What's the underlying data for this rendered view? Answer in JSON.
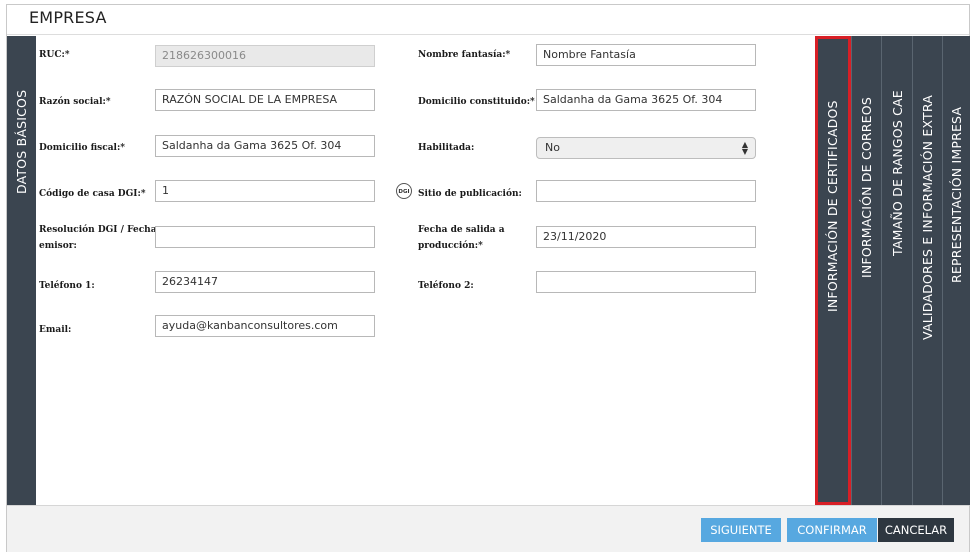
{
  "window": {
    "title": "EMPRESA"
  },
  "left_tab": {
    "label": "DATOS BÁSICOS"
  },
  "form": {
    "ruc": {
      "label": "RUC:*",
      "value": "218626300016"
    },
    "nombre_fantasia": {
      "label": "Nombre fantasía:*",
      "value": "Nombre Fantasía"
    },
    "razon_social": {
      "label": "Razón social:*",
      "value": "RAZÓN SOCIAL DE LA EMPRESA"
    },
    "domicilio_constituido": {
      "label": "Domicilio constituido:*",
      "value": "Saldanha da Gama 3625 Of. 304"
    },
    "domicilio_fiscal": {
      "label": "Domicilio fiscal:*",
      "value": "Saldanha da Gama 3625 Of. 304"
    },
    "habilitada": {
      "label": "Habilitada:",
      "value": "No"
    },
    "codigo_casa": {
      "label": "Código de casa DGI:*",
      "value": "1"
    },
    "dgi_icon": {
      "text": "DGI"
    },
    "sitio_publicacion": {
      "label": "Sitio de publicación:",
      "value": ""
    },
    "resolucion": {
      "label_line1": "Resolución DGI / Fecha",
      "label_line2": "emisor:",
      "value": ""
    },
    "fecha_salida": {
      "label_line1": "Fecha de salida a",
      "label_line2": "producción:*",
      "value": "23/11/2020"
    },
    "telefono1": {
      "label": "Teléfono 1:",
      "value": "26234147"
    },
    "telefono2": {
      "label": "Teléfono 2:",
      "value": ""
    },
    "email": {
      "label": "Email:",
      "value": "ayuda@kanbanconsultores.com"
    }
  },
  "right_tabs": [
    {
      "label": "INFORMACIÓN DE CERTIFICADOS"
    },
    {
      "label": "INFORMACIÓN DE CORREOS"
    },
    {
      "label": "TAMAÑO DE RANGOS CAE"
    },
    {
      "label": "VALIDADORES E INFORMACIÓN EXTRA"
    },
    {
      "label": "REPRESENTACIÓN IMPRESA"
    }
  ],
  "footer": {
    "siguiente": "SIGUIENTE",
    "confirmar": "CONFIRMAR",
    "cancelar": "CANCELAR"
  },
  "colors": {
    "tab_bg": "#3b4550",
    "button_blue": "#57a8e0",
    "button_dark": "#2e3740",
    "highlight": "#d81f26"
  }
}
